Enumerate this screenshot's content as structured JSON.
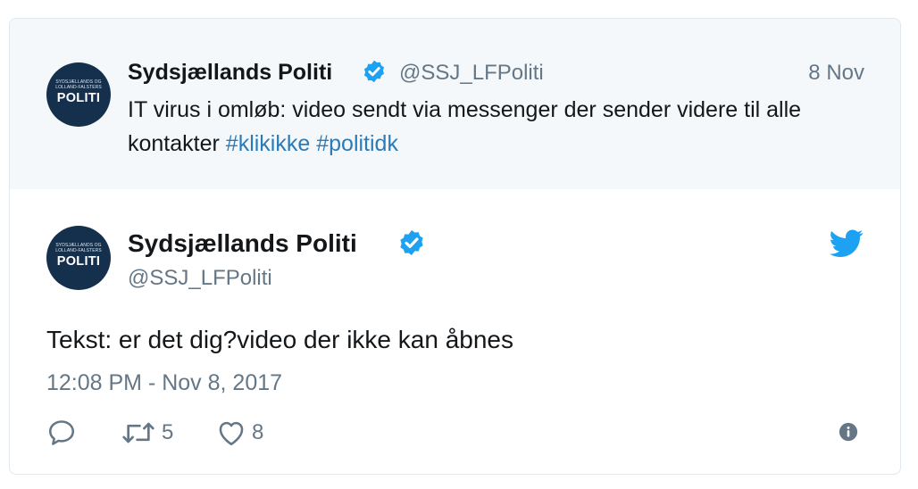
{
  "quoted_tweet": {
    "avatar": {
      "top_text": "SYDSJÆLLANDS OG",
      "bottom_text": "LOLLAND-FALSTERS",
      "brand": "POLITI"
    },
    "display_name": "Sydsjællands Politi",
    "handle": "@SSJ_LFPoliti",
    "date": "8 Nov",
    "text_plain": "IT virus i omløb: video sendt via messenger der sender videre til alle kontakter",
    "hashtags": [
      "#klikikke",
      "#politidk"
    ]
  },
  "main_tweet": {
    "avatar": {
      "top_text": "SYDSJÆLLANDS OG",
      "bottom_text": "LOLLAND-FALSTERS",
      "brand": "POLITI"
    },
    "display_name": "Sydsjællands Politi",
    "handle": "@SSJ_LFPoliti",
    "text": "Tekst: er det dig?video der ikke kan åbnes",
    "timestamp": "12:08 PM - Nov 8, 2017",
    "retweet_count": "5",
    "like_count": "8"
  },
  "icons": {
    "verified": "verified-badge-icon",
    "brand": "twitter-bird-icon",
    "reply": "reply-icon",
    "retweet": "retweet-icon",
    "like": "heart-icon",
    "info": "info-icon"
  },
  "colors": {
    "verified_blue": "#1da1f2",
    "hashtag_blue": "#2b7bb9",
    "muted_text": "#657786",
    "quoted_background": "#f5f8fa",
    "avatar_navy": "#15304d"
  }
}
